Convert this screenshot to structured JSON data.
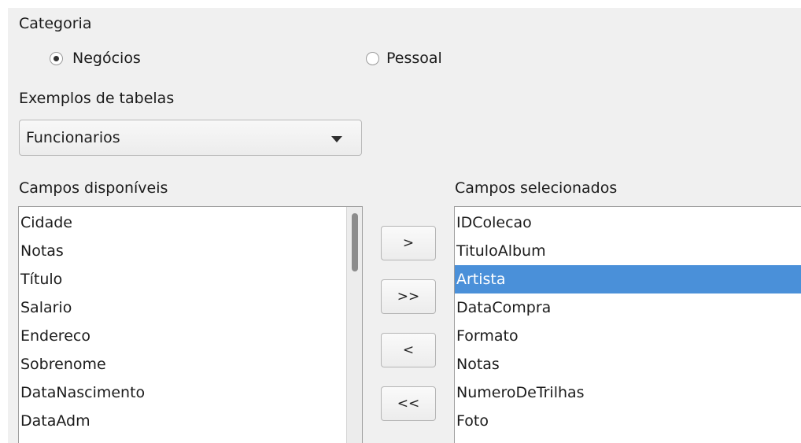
{
  "category": {
    "label": "Categoria",
    "options": [
      {
        "label": "Negócios",
        "selected": true
      },
      {
        "label": "Pessoal",
        "selected": false
      }
    ]
  },
  "sample_tables": {
    "label": "Exemplos de tabelas",
    "selected": "Funcionarios"
  },
  "available_fields": {
    "label": "Campos disponíveis",
    "items": [
      "Cidade",
      "Notas",
      "Título",
      "Salario",
      "Endereco",
      "Sobrenome",
      "DataNascimento",
      "DataAdm"
    ]
  },
  "selected_fields": {
    "label": "Campos selecionados",
    "items": [
      "IDColecao",
      "TituloAlbum",
      "Artista",
      "DataCompra",
      "Formato",
      "Notas",
      "NumeroDeTrilhas",
      "Foto"
    ],
    "highlighted": "Artista"
  },
  "buttons": {
    "add": ">",
    "add_all": ">>",
    "remove": "<",
    "remove_all": "<<"
  },
  "colors": {
    "selection": "#4a90d9",
    "panel_bg": "#f0f0f0"
  }
}
